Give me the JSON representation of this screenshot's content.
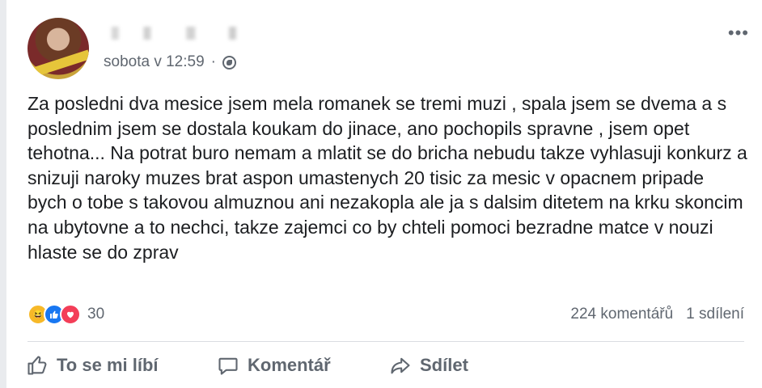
{
  "post": {
    "author_name": "",
    "timestamp": "sobota v 12:59",
    "separator": "·",
    "body": "Za posledni dva mesice jsem mela romanek se tremi muzi , spala jsem se dvema a s poslednim jsem se dostala koukam do jinace, ano pochopils spravne , jsem opet tehotna... Na potrat buro nemam a mlatit se do bricha nebudu takze vyhlasuji konkurz a snizuji naroky muzes brat aspon umastenych 20 tisic za mesic v opacnem pripade bych o tobe s takovou almuznou ani nezakopla ale ja s dalsim ditetem na krku skoncim na ubytovne a to nechci, takze zajemci co by chteli pomoci bezradne matce v nouzi hlaste se do zprav",
    "more_label": "•••"
  },
  "reactions": {
    "icons": [
      "haha-icon",
      "like-icon",
      "love-icon"
    ],
    "count": "30"
  },
  "stats": {
    "comments": "224 komentářů",
    "shares": "1 sdílení"
  },
  "actions": {
    "like": "To se mi líbí",
    "comment": "Komentář",
    "share": "Sdílet"
  },
  "colors": {
    "secondary_text": "#606770",
    "like_blue": "#1877f2",
    "love_red": "#f33e58",
    "haha_yellow": "#f7b928"
  }
}
